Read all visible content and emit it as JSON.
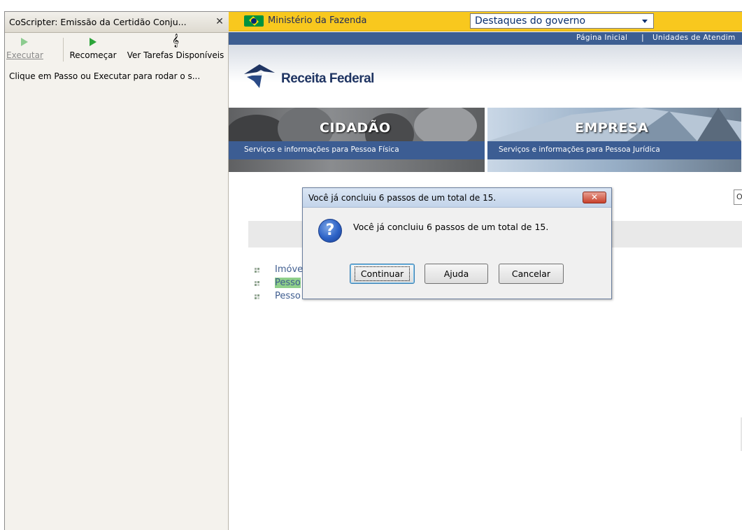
{
  "sidebar": {
    "title": "CoScripter: Emissão da Certidão Conju...",
    "close_glyph": "✕",
    "toolbar": {
      "execute_label": "Executar",
      "restart_label": "Recomeçar",
      "tasks_label": "Ver Tarefas Disponíveis",
      "tasks_icon_glyph": "𝄞"
    },
    "hint": "Clique em Passo ou Executar para rodar o s..."
  },
  "page": {
    "gov_bar": {
      "ministry": "Ministério da Fazenda",
      "select_value": "Destaques do governo"
    },
    "top_nav": {
      "home": "Página Inicial",
      "separator": "|",
      "units": "Unidades de Atendim"
    },
    "logo_text": "Receita Federal",
    "tabs": [
      {
        "title": "CIDADÃO",
        "subtitle": "Serviços e informações para Pessoa Física"
      },
      {
        "title": "EMPRESA",
        "subtitle": "Serviços e informações para Pessoa Jurídica"
      }
    ],
    "or_field": "Or",
    "links": [
      {
        "label": "Imóvel"
      },
      {
        "label": "Pesso"
      },
      {
        "label": "Pesso"
      }
    ]
  },
  "dialog": {
    "title": "Você já concluiu 6 passos de um total de 15.",
    "message": "Você já concluiu 6 passos de um total de 15.",
    "close_glyph": "✕",
    "icon_glyph": "?",
    "buttons": {
      "continue": "Continuar",
      "help": "Ajuda",
      "cancel": "Cancelar"
    }
  },
  "colors": {
    "gov_bar": "#f8c81e",
    "nav_blue": "#3d5e92",
    "link_blue": "#3f5d8f",
    "highlight": "#8fd08a"
  }
}
